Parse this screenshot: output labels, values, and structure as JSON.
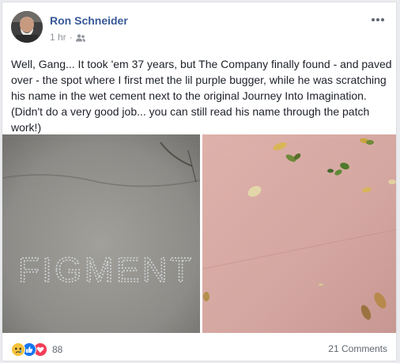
{
  "post": {
    "author": "Ron Schneider",
    "time": "1 hr",
    "separator": "·",
    "audience_icon": "friends-icon",
    "text": "Well, Gang... It took 'em 37 years, but The Company finally found - and paved over - the spot where I first met the lil purple bugger, while he was scratching his name in the wet cement next to the original Journey Into Imagination. (Didn't do a very good job... you can still read his name through the patch work!)",
    "photo_left_text": "FIGMENT",
    "reactions": {
      "icons": [
        "sad-reaction-icon",
        "like-reaction-icon",
        "love-reaction-icon"
      ],
      "count": "88"
    },
    "comments": "21 Comments"
  },
  "colors": {
    "author_link": "#385898",
    "meta_gray": "#90949c",
    "cement_gray": "#8c8b87",
    "pink_paving": "#d9a9a3"
  }
}
